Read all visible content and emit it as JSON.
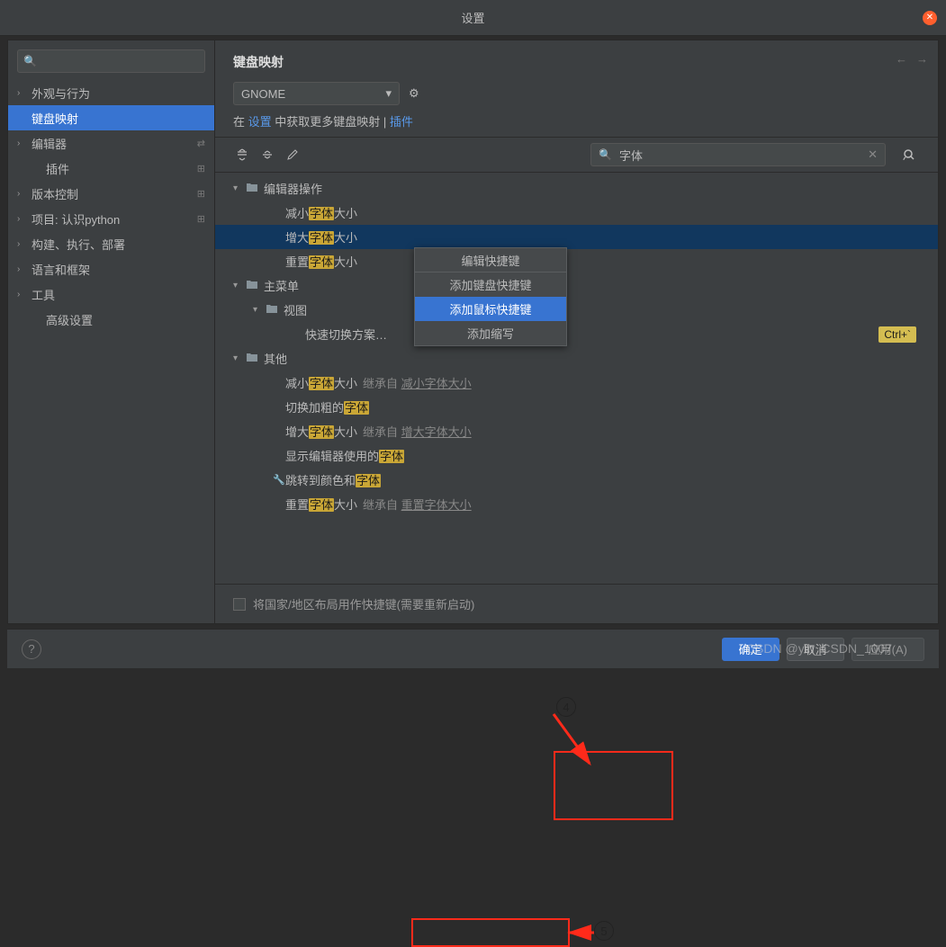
{
  "window": {
    "title": "设置"
  },
  "sidebar": {
    "search_placeholder": "",
    "items": [
      {
        "label": "外观与行为",
        "expandable": true
      },
      {
        "label": "键盘映射",
        "expandable": false,
        "selected": true
      },
      {
        "label": "编辑器",
        "expandable": true,
        "badge": "⇄"
      },
      {
        "label": "插件",
        "expandable": false,
        "indent": true,
        "badge": "⊞"
      },
      {
        "label": "版本控制",
        "expandable": true,
        "badge": "⊞"
      },
      {
        "label": "项目: 认识python",
        "expandable": true,
        "badge": "⊞"
      },
      {
        "label": "构建、执行、部署",
        "expandable": true
      },
      {
        "label": "语言和框架",
        "expandable": true
      },
      {
        "label": "工具",
        "expandable": true
      },
      {
        "label": "高级设置",
        "expandable": false,
        "indent": true
      }
    ]
  },
  "content": {
    "title": "键盘映射",
    "scheme": "GNOME",
    "hint_prefix": "在 ",
    "hint_link1": "设置",
    "hint_mid": " 中获取更多键盘映射 | ",
    "hint_link2": "插件",
    "search_value": "字体"
  },
  "tree": [
    {
      "level": 0,
      "expanded": true,
      "icon": "folder",
      "text": [
        {
          "t": "编辑器操作"
        }
      ]
    },
    {
      "level": 2,
      "text": [
        {
          "t": "减小"
        },
        {
          "hl": "字体"
        },
        {
          "t": "大小"
        }
      ]
    },
    {
      "level": 2,
      "selected": true,
      "text": [
        {
          "t": "增大"
        },
        {
          "hl": "字体"
        },
        {
          "t": "大小"
        }
      ]
    },
    {
      "level": 2,
      "text": [
        {
          "t": "重置"
        },
        {
          "hl": "字体"
        },
        {
          "t": "大小"
        }
      ]
    },
    {
      "level": 0,
      "expanded": true,
      "icon": "folder",
      "text": [
        {
          "t": "主菜单"
        }
      ]
    },
    {
      "level": 1,
      "expanded": true,
      "icon": "folder-o",
      "text": [
        {
          "t": "视图"
        }
      ]
    },
    {
      "level": 3,
      "text": [
        {
          "t": "快速切换方案…"
        }
      ],
      "shortcut": "Ctrl+`"
    },
    {
      "level": 0,
      "expanded": true,
      "icon": "folder-c",
      "text": [
        {
          "t": "其他"
        }
      ]
    },
    {
      "level": 2,
      "text": [
        {
          "t": "减小"
        },
        {
          "hl": "字体"
        },
        {
          "t": "大小"
        }
      ],
      "inherit_pre": "继承自 ",
      "inherit_link": "减小字体大小"
    },
    {
      "level": 2,
      "text": [
        {
          "t": "切换加粗的"
        },
        {
          "hl": "字体"
        }
      ]
    },
    {
      "level": 2,
      "text": [
        {
          "t": "增大"
        },
        {
          "hl": "字体"
        },
        {
          "t": "大小"
        }
      ],
      "inherit_pre": "继承自 ",
      "inherit_link": "增大字体大小"
    },
    {
      "level": 2,
      "text": [
        {
          "t": "显示编辑器使用的"
        },
        {
          "hl": "字体"
        }
      ]
    },
    {
      "level": 2,
      "icon": "wrench",
      "text": [
        {
          "t": "跳转到颜色和"
        },
        {
          "hl": "字体"
        }
      ]
    },
    {
      "level": 2,
      "text": [
        {
          "t": "重置"
        },
        {
          "hl": "字体"
        },
        {
          "t": "大小"
        }
      ],
      "inherit_pre": "继承自 ",
      "inherit_link": "重置字体大小"
    }
  ],
  "context_menu": {
    "header": "编辑快捷键",
    "items": [
      "添加键盘快捷键",
      "添加鼠标快捷键",
      "添加缩写"
    ],
    "highlighted_index": 1
  },
  "footer": {
    "checkbox_label": "将国家/地区布局用作快捷键(需要重新启动)"
  },
  "buttons": {
    "ok": "确定",
    "cancel": "取消",
    "apply": "应用(A)"
  },
  "annotations": {
    "num4": "4",
    "num5": "5"
  },
  "watermark": "CSDN @yin_CSDN_1007"
}
